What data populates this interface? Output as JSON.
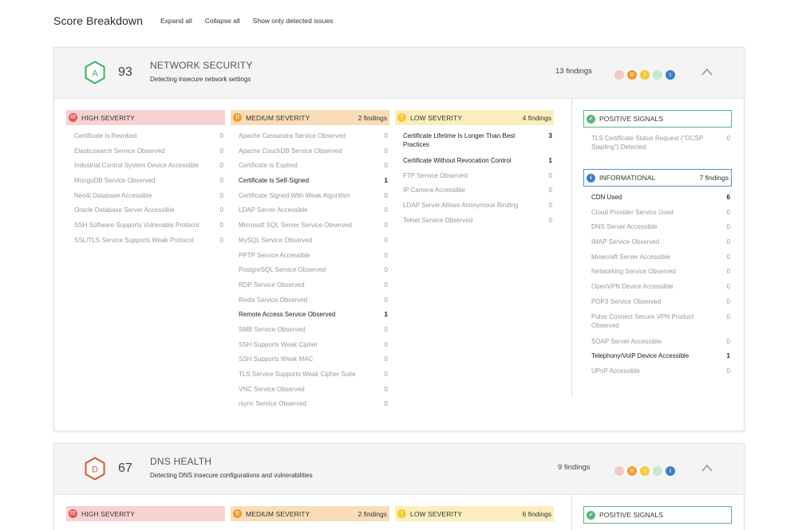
{
  "page": {
    "title": "Score Breakdown",
    "links": [
      "Expand all",
      "Collapse all",
      "Show only detected issues"
    ]
  },
  "colors": {
    "grade_a": "#3fae5a",
    "grade_d": "#e0512f",
    "high": "#e35454",
    "medium": "#f29b2c",
    "low": "#f5c933",
    "positive": "#58b77e",
    "info": "#3d7cc9"
  },
  "network": {
    "grade": "A",
    "score": "93",
    "title": "NETWORK SECURITY",
    "description": "Detecting insecure network settings",
    "findings": "13 findings",
    "high": {
      "label": "HIGH SEVERITY",
      "count": "",
      "items": [
        {
          "name": "Certificate Is Revoked",
          "n": "0"
        },
        {
          "name": "Elasticsearch Service Observed",
          "n": "0"
        },
        {
          "name": "Industrial Control System Device Accessible",
          "n": "0"
        },
        {
          "name": "MongoDB Service Observed",
          "n": "0"
        },
        {
          "name": "Neo4j Database Accessible",
          "n": "0"
        },
        {
          "name": "Oracle Database Server Accessible",
          "n": "0"
        },
        {
          "name": "SSH Software Supports Vulnerable Protocol",
          "n": "0"
        },
        {
          "name": "SSL/TLS Service Supports Weak Protocol",
          "n": "0"
        }
      ]
    },
    "medium": {
      "label": "MEDIUM SEVERITY",
      "count": "2 findings",
      "items": [
        {
          "name": "Apache Cassandra Service Observed",
          "n": "0"
        },
        {
          "name": "Apache CouchDB Service Observed",
          "n": "0"
        },
        {
          "name": "Certificate Is Expired",
          "n": "0"
        },
        {
          "name": "Certificate Is Self-Signed",
          "n": "1"
        },
        {
          "name": "Certificate Signed With Weak Algorithm",
          "n": "0"
        },
        {
          "name": "LDAP Server Accessible",
          "n": "0"
        },
        {
          "name": "Microsoft SQL Server Service Observed",
          "n": "0"
        },
        {
          "name": "MySQL Service Observed",
          "n": "0"
        },
        {
          "name": "PPTP Service Accessible",
          "n": "0"
        },
        {
          "name": "PostgreSQL Service Observed",
          "n": "0"
        },
        {
          "name": "RDP Service Observed",
          "n": "0"
        },
        {
          "name": "Redis Service Observed",
          "n": "0"
        },
        {
          "name": "Remote Access Service Observed",
          "n": "1"
        },
        {
          "name": "SMB Service Observed",
          "n": "0"
        },
        {
          "name": "SSH Supports Weak Cipher",
          "n": "0"
        },
        {
          "name": "SSH Supports Weak MAC",
          "n": "0"
        },
        {
          "name": "TLS Service Supports Weak Cipher Suite",
          "n": "0"
        },
        {
          "name": "VNC Service Observed",
          "n": "0"
        },
        {
          "name": "rsync Service Observed",
          "n": "0"
        }
      ]
    },
    "low": {
      "label": "LOW SEVERITY",
      "count": "4 findings",
      "items": [
        {
          "name": "Certificate Lifetime Is Longer Than Best Practices",
          "n": "3"
        },
        {
          "name": "Certificate Without Revocation Control",
          "n": "1"
        },
        {
          "name": "FTP Service Observed",
          "n": "0"
        },
        {
          "name": "IP Camera Accessible",
          "n": "0"
        },
        {
          "name": "LDAP Server Allows Anonymous Binding",
          "n": "0"
        },
        {
          "name": "Telnet Service Observed",
          "n": "0"
        }
      ]
    },
    "positive": {
      "label": "POSITIVE SIGNALS",
      "items": [
        {
          "name": "TLS Certificate Status Request (\"OCSP Stapling\") Detected",
          "n": "0"
        }
      ]
    },
    "info": {
      "label": "INFORMATIONAL",
      "count": "7 findings",
      "items": [
        {
          "name": "CDN Used",
          "n": "6"
        },
        {
          "name": "Cloud Provider Service Used",
          "n": "0"
        },
        {
          "name": "DNS Server Accessible",
          "n": "0"
        },
        {
          "name": "IMAP Service Observed",
          "n": "0"
        },
        {
          "name": "Minecraft Server Accessible",
          "n": "0"
        },
        {
          "name": "Networking Service Observed",
          "n": "0"
        },
        {
          "name": "OpenVPN Device Accessible",
          "n": "0"
        },
        {
          "name": "POP3 Service Observed",
          "n": "0"
        },
        {
          "name": "Pulse Connect Secure VPN Product Observed",
          "n": "0"
        },
        {
          "name": "SOAP Server Accessible",
          "n": "0"
        },
        {
          "name": "Telephony/VoIP Device Accessible",
          "n": "1"
        },
        {
          "name": "UPnP Accessible",
          "n": "0"
        }
      ]
    }
  },
  "dns": {
    "grade": "D",
    "score": "67",
    "title": "DNS HEALTH",
    "description": "Detecting DNS insecure configurations and vulnerabilities",
    "findings": "9 findings",
    "high": {
      "label": "HIGH SEVERITY",
      "count": ""
    },
    "medium": {
      "label": "MEDIUM SEVERITY",
      "count": "2 findings"
    },
    "low": {
      "label": "LOW SEVERITY",
      "count": "6 findings"
    },
    "positive": {
      "label": "POSITIVE SIGNALS"
    }
  }
}
